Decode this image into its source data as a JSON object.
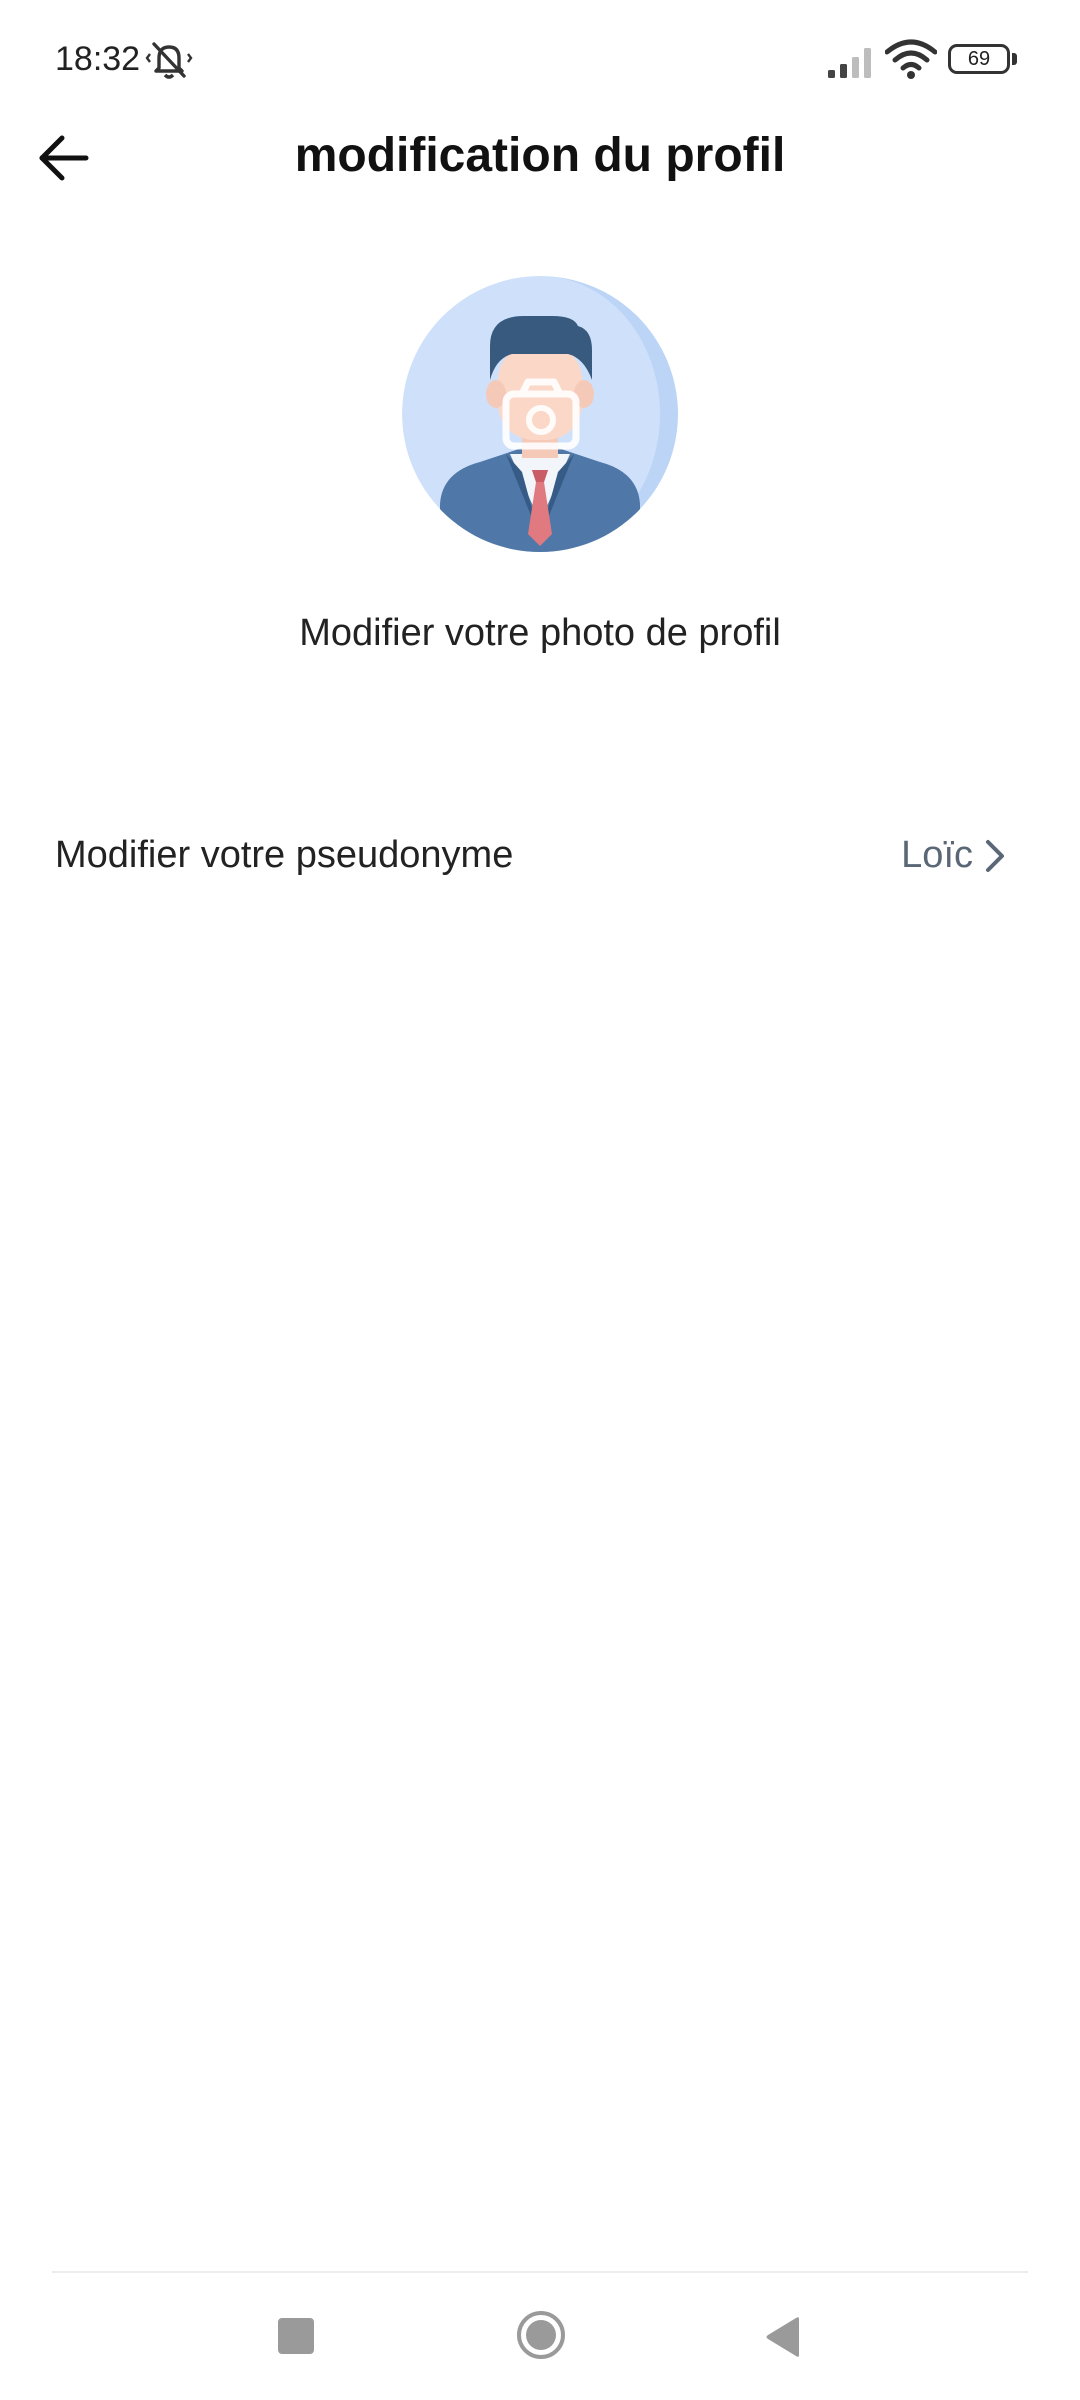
{
  "status_bar": {
    "time": "18:32",
    "battery_level": "69",
    "icons": [
      "bell-off-icon",
      "signal-icon",
      "wifi-icon",
      "battery-icon"
    ]
  },
  "header": {
    "title": "modification du profil",
    "back_icon": "arrow-left-icon"
  },
  "profile": {
    "photo_label": "Modifier votre photo de profil",
    "avatar_icon": "avatar-with-camera-icon",
    "colors": {
      "avatar_bg": "#cfe1fa",
      "suit": "#4f78a8",
      "hair": "#375a7e",
      "tie": "#e07a80"
    }
  },
  "pseudonym": {
    "label": "Modifier votre pseudonyme",
    "value": "Loïc",
    "icon": "chevron-right-icon"
  },
  "nav_bar": {
    "buttons": [
      "recent-apps-button",
      "home-button",
      "back-button"
    ]
  }
}
